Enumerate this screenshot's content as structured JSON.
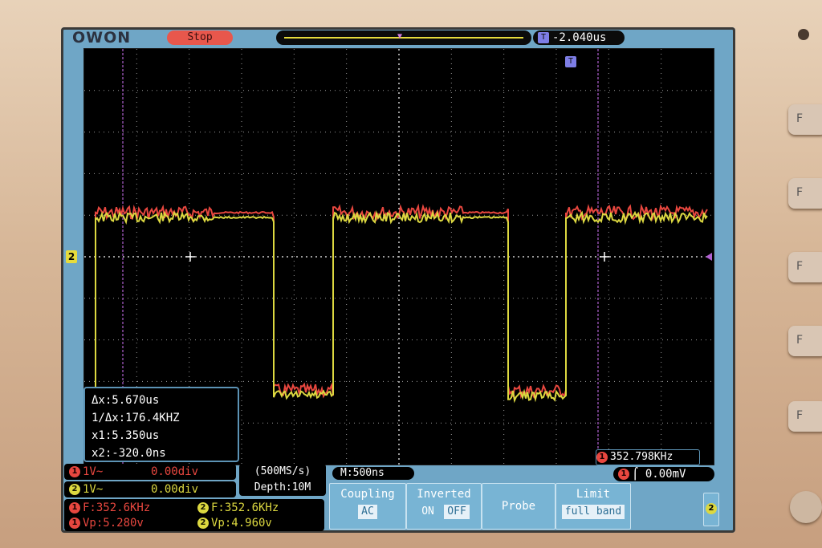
{
  "device": {
    "brand": "OWON"
  },
  "top_bar": {
    "status": "Stop",
    "trigger_position": "-2.040us",
    "trigger_icon": "T"
  },
  "channel_marker": "2",
  "cursor_readout": {
    "delta_x": "Δx:5.670us",
    "inv_delta_x": "1/Δx:176.4KHZ",
    "x1": "x1:5.350us",
    "x2": "x2:-320.0ns"
  },
  "freq_counter": "352.798KHz",
  "channels": [
    {
      "id": "1",
      "coupling": "1V~",
      "offset": "0.00div",
      "color": "#e8473f"
    },
    {
      "id": "2",
      "coupling": "1V~",
      "offset": "0.00div",
      "color": "#dcd840"
    }
  ],
  "acquisition": {
    "sample_rate": "(500MS/s)",
    "depth": "Depth:10M"
  },
  "measurements": {
    "ch1_freq": "F:352.6KHz",
    "ch2_freq": "F:352.6KHz",
    "ch1_vp": "Vp:5.280v",
    "ch2_vp": "Vp:4.960v"
  },
  "timebase": "M:500ns",
  "trigger_level": "0.00mV",
  "menu": {
    "coupling": {
      "label": "Coupling",
      "value": "AC"
    },
    "inverted": {
      "label": "Inverted",
      "on": "ON",
      "off": "OFF"
    },
    "probe": {
      "label": "Probe"
    },
    "limit": {
      "label": "Limit",
      "value": "full band"
    }
  },
  "side_label": "2",
  "function_keys": [
    "F",
    "F",
    "F",
    "F",
    "F"
  ],
  "waveform": {
    "ch1_color": "#e8473f",
    "ch2_color": "#dcd840",
    "grid_color": "#9a9a9a",
    "cursor_color": "#b060d0"
  }
}
